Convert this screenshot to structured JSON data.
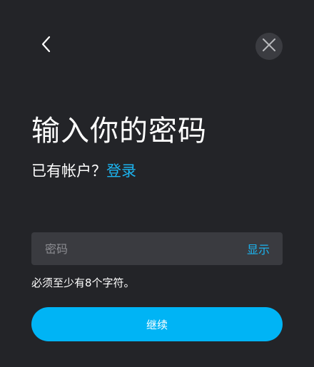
{
  "header": {
    "back_icon": "chevron-left-icon",
    "close_icon": "close-icon"
  },
  "title": "输入你的密码",
  "login_prompt": {
    "text": "已有帐户？",
    "link_label": "登录"
  },
  "password_field": {
    "placeholder": "密码",
    "value": "",
    "toggle_label": "显示"
  },
  "hint": "必须至少有8个字符。",
  "continue_label": "继续",
  "colors": {
    "background": "#232428",
    "accent": "#1cb4f0",
    "button": "#00b4f5",
    "field_background": "#3a3b40",
    "close_background": "#3b3c41"
  }
}
